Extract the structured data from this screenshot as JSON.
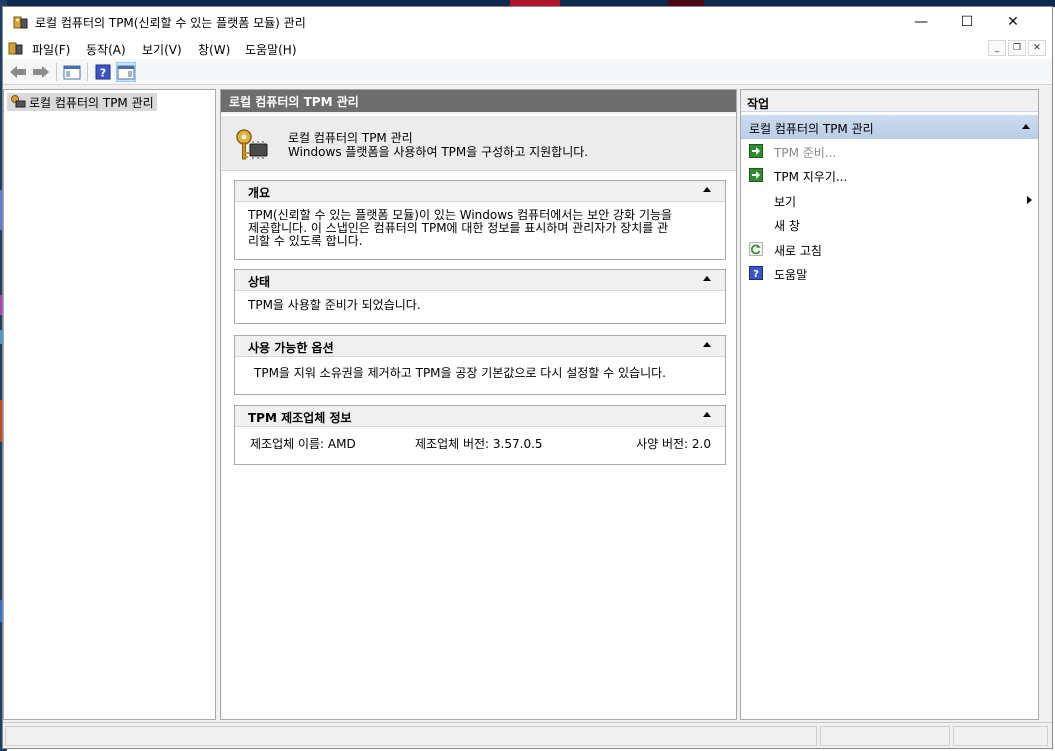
{
  "window": {
    "title": "로컬 컴퓨터의 TPM(신뢰할 수 있는 플랫폼 모듈) 관리",
    "minimize": "—",
    "maximize": "☐",
    "close": "✕"
  },
  "menu": {
    "items": [
      "파일(F)",
      "동작(A)",
      "보기(V)",
      "창(W)",
      "도움말(H)"
    ]
  },
  "toolbar": {
    "icons": [
      "back-icon",
      "forward-icon",
      "show-hide-tree-icon",
      "help-icon",
      "show-hide-action-pane-icon"
    ]
  },
  "tree": {
    "root_label": "로컬 컴퓨터의 TPM 관리"
  },
  "center": {
    "header": "로컬 컴퓨터의 TPM 관리",
    "intro_title": "로컬 컴퓨터의 TPM 관리",
    "intro_desc": "Windows 플랫폼을 사용하여 TPM을 구성하고 지원합니다.",
    "sections": {
      "overview": {
        "title": "개요",
        "body_line1": "TPM(신뢰할 수 있는 플랫폼 모듈)이 있는 Windows 컴퓨터에서는 보안 강화 기능을",
        "body_line2": "제공합니다. 이 스냅인은 컴퓨터의 TPM에 대한 정보를 표시하며 관리자가 장치를 관",
        "body_line3": "리할 수 있도록 합니다."
      },
      "status": {
        "title": "상태",
        "body": "TPM을 사용할 준비가 되었습니다."
      },
      "options": {
        "title": "사용 가능한 옵션",
        "body": "TPM을 지워 소유권을 제거하고 TPM을 공장 기본값으로 다시 설정할 수 있습니다."
      },
      "manufacturer": {
        "title": "TPM 제조업체 정보",
        "name": "제조업체 이름: AMD",
        "version": "제조업체 버전: 3.57.0.5",
        "spec": "사양 버전: 2.0"
      }
    }
  },
  "actions": {
    "title": "작업",
    "group": "로컬 컴퓨터의 TPM 관리",
    "items": [
      {
        "label": "TPM 준비...",
        "icon": "run-action-icon",
        "enabled": false
      },
      {
        "label": "TPM 지우기...",
        "icon": "run-action-icon",
        "enabled": true
      },
      {
        "label": "보기",
        "icon": "",
        "enabled": true
      },
      {
        "label": "새 창",
        "icon": "",
        "enabled": true
      },
      {
        "label": "새로 고침",
        "icon": "refresh-icon",
        "enabled": true
      },
      {
        "label": "도움말",
        "icon": "help-icon",
        "enabled": true
      }
    ]
  },
  "colors": {
    "center_header": "#6d6d6d",
    "actions_group": "#b8cde6",
    "action_icon_green": "#2e8b2e"
  }
}
